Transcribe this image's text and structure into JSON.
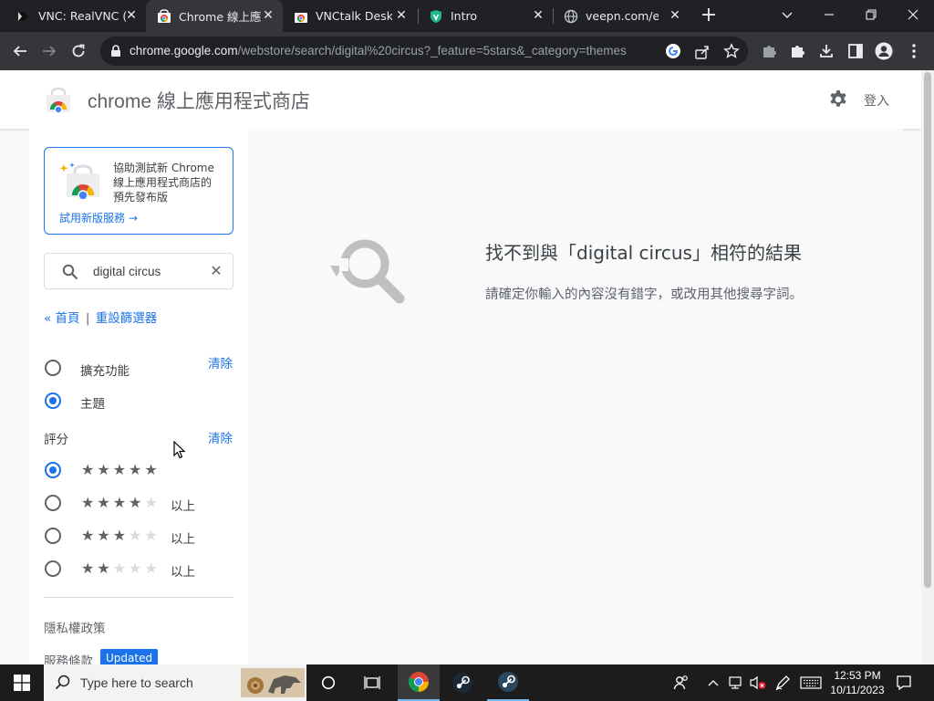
{
  "browser": {
    "tabs": [
      {
        "title": "VNC: RealVNC (",
        "active": false,
        "favicon": "realvnc-icon"
      },
      {
        "title": "Chrome 線上應",
        "active": true,
        "favicon": "webstore-icon"
      },
      {
        "title": "VNCtalk Deskto",
        "active": false,
        "favicon": "webstore-icon"
      },
      {
        "title": "Intro",
        "active": false,
        "favicon": "veepn-shield-icon"
      },
      {
        "title": "veepn.com/en/",
        "active": false,
        "favicon": "globe-icon"
      }
    ],
    "url_host": "chrome.google.com",
    "url_path": "/webstore/search/digital%20circus?_feature=5stars&_category=themes"
  },
  "store": {
    "title": "chrome 線上應用程式商店",
    "signin": "登入"
  },
  "sidebar": {
    "promo_text": "協助測試新 Chrome 線上應用程式商店的預先發布版",
    "promo_link": "試用新版服務 →",
    "search_value": "digital circus",
    "crumb_home": "« 首頁",
    "crumb_sep": "|",
    "crumb_reset": "重設篩選器",
    "category_clear": "清除",
    "categories": [
      {
        "label": "擴充功能",
        "selected": false
      },
      {
        "label": "主題",
        "selected": true
      }
    ],
    "rating_title": "評分",
    "rating_clear": "清除",
    "ratings": [
      {
        "stars": 5,
        "suffix": "",
        "selected": true
      },
      {
        "stars": 4,
        "suffix": "以上",
        "selected": false
      },
      {
        "stars": 3,
        "suffix": "以上",
        "selected": false
      },
      {
        "stars": 2,
        "suffix": "以上",
        "selected": false
      }
    ],
    "privacy": "隱私權政策",
    "terms": "服務條款",
    "terms_badge": "Updated"
  },
  "results": {
    "title": "找不到與「digital circus」相符的結果",
    "subtitle": "請確定你輸入的內容沒有錯字，或改用其他搜尋字詞。"
  },
  "taskbar": {
    "search_placeholder": "Type here to search",
    "time": "12:53 PM",
    "date": "10/11/2023"
  },
  "colors": {
    "accent": "#1a73e8",
    "tab_bg": "#202124",
    "toolbar_bg": "#35363a"
  }
}
